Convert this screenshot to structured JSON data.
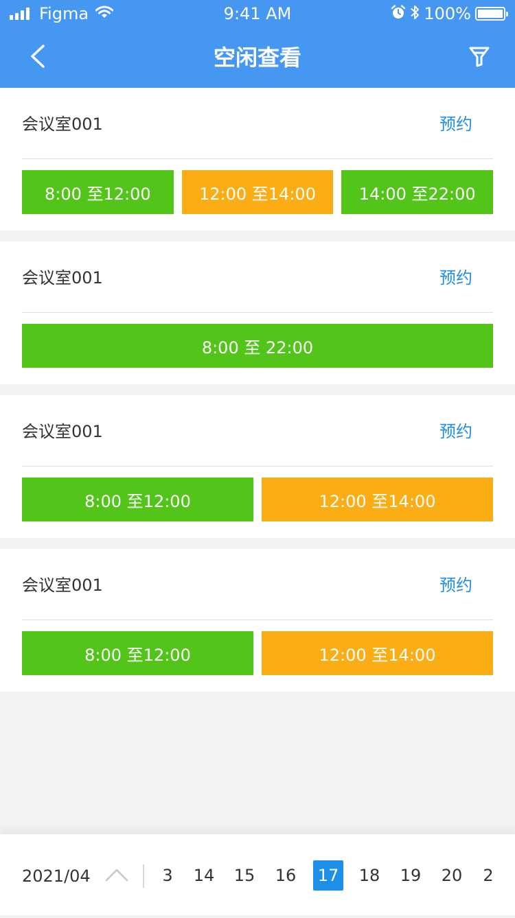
{
  "status_bar": {
    "carrier": "Figma",
    "time": "9:41 AM",
    "battery": "100%"
  },
  "nav": {
    "title": "空闲查看"
  },
  "colors": {
    "header": "#4597f2",
    "free_slot": "#52c41a",
    "busy_slot": "#faad14",
    "link": "#1e8fe6",
    "selected_day": "#1e8fe6"
  },
  "rooms": [
    {
      "name": "会议室001",
      "action": "预约",
      "slots": [
        {
          "label": "8:00 至12:00",
          "status": "free"
        },
        {
          "label": "12:00 至14:00",
          "status": "busy"
        },
        {
          "label": "14:00 至22:00",
          "status": "free"
        }
      ]
    },
    {
      "name": "会议室001",
      "action": "预约",
      "slots": [
        {
          "label": "8:00 至 22:00",
          "status": "free"
        }
      ]
    },
    {
      "name": "会议室001",
      "action": "预约",
      "slots": [
        {
          "label": "8:00 至12:00",
          "status": "free"
        },
        {
          "label": "12:00 至14:00",
          "status": "busy"
        }
      ]
    },
    {
      "name": "会议室001",
      "action": "预约",
      "slots": [
        {
          "label": "8:00 至12:00",
          "status": "free"
        },
        {
          "label": "12:00 至14:00",
          "status": "busy"
        }
      ]
    }
  ],
  "date_bar": {
    "month": "2021/04",
    "days": [
      "3",
      "14",
      "15",
      "16",
      "17",
      "18",
      "19",
      "20",
      "2"
    ],
    "selected": "17"
  }
}
